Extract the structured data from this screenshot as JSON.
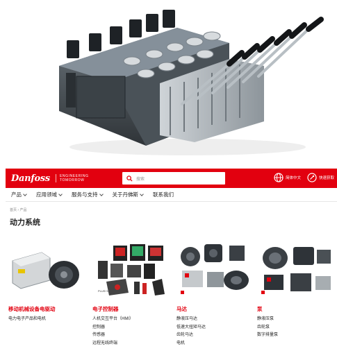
{
  "header": {
    "logo": "Danfoss",
    "tagline_line1": "ENGINEERING",
    "tagline_line2": "TOMORROW",
    "search_placeholder": "搜索",
    "language": "简体中文",
    "quick_support": "快速获取"
  },
  "nav": {
    "items": [
      {
        "label": "产品",
        "has_menu": true
      },
      {
        "label": "应用领域",
        "has_menu": true
      },
      {
        "label": "服务与支持",
        "has_menu": true
      },
      {
        "label": "关于丹佛斯",
        "has_menu": true
      },
      {
        "label": "联系我们",
        "has_menu": false
      }
    ]
  },
  "breadcrumb": "首页 › 产品",
  "page_title": "动力系统",
  "categories": [
    {
      "title": "移动机械设备电驱动",
      "links": [
        "电力电子产品和电机"
      ],
      "badge": ""
    },
    {
      "title": "电子控制器",
      "links": [
        "人机交互平台（HMI）",
        "控制器",
        "传感器",
        "远程无线终端"
      ],
      "badge": "PLUS+1"
    },
    {
      "title": "马达",
      "links": [
        "静液压马达",
        "低速大扭矩马达",
        "齿轮马达",
        "电机"
      ],
      "badge": ""
    },
    {
      "title": "泵",
      "links": [
        "静液压泵",
        "齿轮泵",
        "数字排量泵"
      ],
      "badge": ""
    }
  ],
  "colors": {
    "brand_red": "#e2000f"
  }
}
